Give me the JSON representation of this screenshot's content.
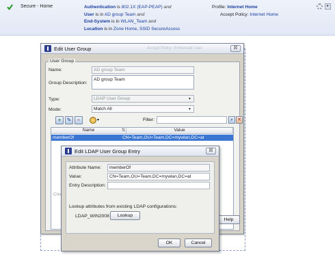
{
  "policy_row": {
    "rule_name": "Secure - Home",
    "conditions": [
      {
        "key": "Authentication",
        "mid": " is ",
        "value": "802.1X (EAP-PEAP)",
        "join": " and"
      },
      {
        "key": "User",
        "mid": " is in ",
        "value": "AD group Team",
        "join": " and"
      },
      {
        "key": "End-System",
        "mid": " is in ",
        "value": "WLAN_Team",
        "join": " and"
      },
      {
        "key": "Location",
        "mid": " is in ",
        "value": "Zone Home, SSID SecureAccess",
        "join": ""
      }
    ],
    "profile_label": "Profile:",
    "profile_value": "Internet Home",
    "accept_label": "Accept Policy:",
    "accept_value": "Internet Home",
    "icons": [
      "checkmark-icon",
      "gear-icon",
      "row-menu-icon"
    ]
  },
  "outer_dialog": {
    "title": "Edit User Group",
    "ghost_title": "Accept Policy: Enhanced User",
    "group_legend": "User Group",
    "name_label": "Name:",
    "name_value": "AD group Team",
    "desc_label": "Group Description:",
    "desc_value": "AD group Team",
    "type_label": "Type:",
    "type_value": "LDAP User Group",
    "mode_label": "Mode:",
    "mode_value": "Match All",
    "filter_label": "Filter:",
    "filter_value": "",
    "columns": [
      "Name",
      "Value"
    ],
    "rows": [
      {
        "name": "memberOf",
        "value": "CN=Team,OU=Team,DC=mywlan,DC=at"
      }
    ],
    "created_text": "Crea",
    "help_label": "Help",
    "close_glyph": "☒"
  },
  "inner_dialog": {
    "title": "Edit LDAP User Group Entry",
    "attr_label": "Attribute Name:",
    "attr_value": "memberOf",
    "value_label": "Value:",
    "value_value": "CN=Team,OU=Team,DC=mywlan,DC=at",
    "entry_label": "Entry Description:",
    "entry_value": "",
    "lookup_note": "Lookup attributes from existing LDAP configurations:",
    "server_name": "LDAP_WIN2008",
    "lookup_label": "Lookup",
    "ok_label": "OK",
    "cancel_label": "Cancel",
    "close_glyph": "☒"
  },
  "colors": {
    "selection_blue": "#3b76d2",
    "link_blue": "#1a3e9e",
    "check_green": "#2e9b2e",
    "dialog_bg": "#d6d2c6"
  }
}
